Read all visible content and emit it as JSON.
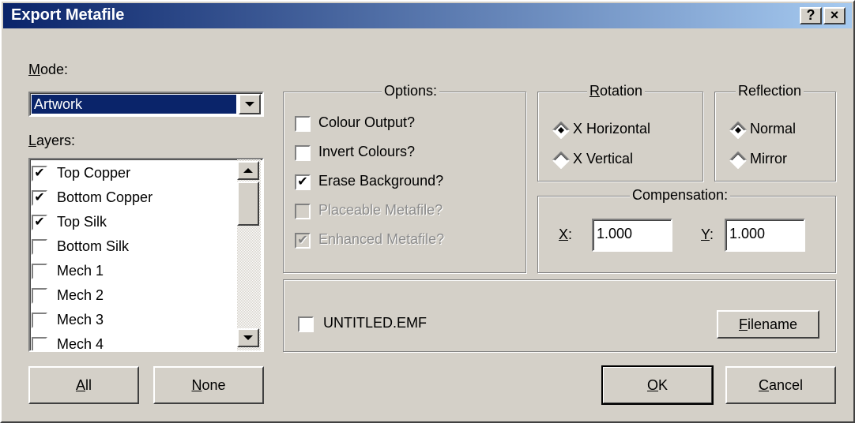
{
  "window": {
    "title": "Export Metafile",
    "help_label": "?",
    "close_label": "×"
  },
  "mode": {
    "label": "Mode:",
    "value": "Artwork"
  },
  "layers": {
    "label": "Layers:",
    "items": [
      {
        "label": "Top Copper",
        "checked": true
      },
      {
        "label": "Bottom Copper",
        "checked": true
      },
      {
        "label": "Top Silk",
        "checked": true
      },
      {
        "label": "Bottom Silk",
        "checked": false
      },
      {
        "label": "Mech 1",
        "checked": false
      },
      {
        "label": "Mech 2",
        "checked": false
      },
      {
        "label": "Mech 3",
        "checked": false
      },
      {
        "label": "Mech 4",
        "checked": false
      }
    ]
  },
  "options": {
    "title": "Options:",
    "items": [
      {
        "label": "Colour Output?",
        "checked": false,
        "enabled": true
      },
      {
        "label": "Invert Colours?",
        "checked": false,
        "enabled": true
      },
      {
        "label": "Erase Background?",
        "checked": true,
        "enabled": true
      },
      {
        "label": "Placeable Metafile?",
        "checked": false,
        "enabled": false
      },
      {
        "label": "Enhanced Metafile?",
        "checked": true,
        "enabled": false
      }
    ]
  },
  "rotation": {
    "title": "Rotation",
    "options": [
      {
        "label": "X Horizontal",
        "selected": true
      },
      {
        "label": "X Vertical",
        "selected": false
      }
    ]
  },
  "reflection": {
    "title": "Reflection",
    "options": [
      {
        "label": "Normal",
        "selected": true
      },
      {
        "label": "Mirror",
        "selected": false
      }
    ]
  },
  "compensation": {
    "title": "Compensation:",
    "x_label": "X:",
    "x_value": "1.000",
    "y_label": "Y:",
    "y_value": "1.000"
  },
  "file": {
    "label": "UNTITLED.EMF",
    "checked": false,
    "button_label": "Filename"
  },
  "buttons": {
    "all": "All",
    "none": "None",
    "ok": "OK",
    "cancel": "Cancel"
  }
}
